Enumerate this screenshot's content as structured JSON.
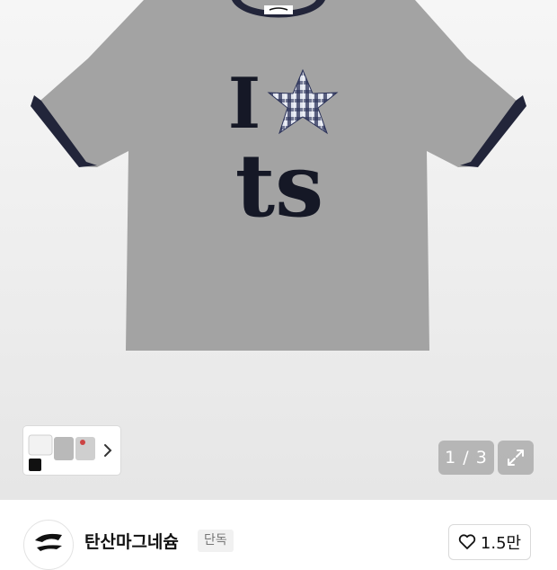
{
  "product_image": {
    "graphic_text_line1": "I",
    "graphic_text_line2": "ts",
    "label_text": "SAN MAGNESIUM"
  },
  "gallery": {
    "current": "1",
    "total": "3",
    "indicator": "1 / 3"
  },
  "icons": {
    "thumbnail_next": "chevron-right-icon",
    "expand": "expand-icon",
    "like": "heart-icon"
  },
  "brand": {
    "name": "탄산마그네슘",
    "badge": "단독",
    "logo_text": "tansanmagnesium"
  },
  "like": {
    "count": "1.5만"
  },
  "colors": {
    "shirt_gray": "#a3a3a3",
    "ringer_navy": "#22253a",
    "badge_bg": "#f1f1f1"
  }
}
